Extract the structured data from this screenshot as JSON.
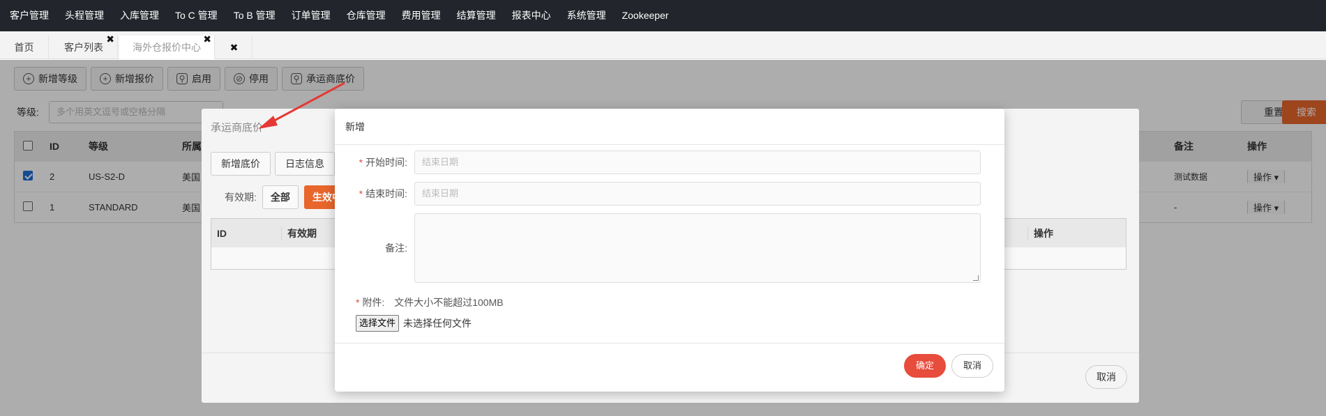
{
  "nav": {
    "items": [
      "客户管理",
      "头程管理",
      "入库管理",
      "To C 管理",
      "To B 管理",
      "订单管理",
      "仓库管理",
      "费用管理",
      "结算管理",
      "报表中心",
      "系统管理",
      "Zookeeper"
    ]
  },
  "tabs": {
    "home": "首页",
    "customer_list": "客户列表",
    "quote_center": "海外仓报价中心",
    "close_glyph": "✖"
  },
  "toolbar": {
    "add_level": "新增等级",
    "add_quote": "新增报价",
    "enable": "启用",
    "disable": "停用",
    "carrier_floor": "承运商底价"
  },
  "filter": {
    "level_label": "等级:",
    "level_placeholder": "多个用英文逗号或空格分隔",
    "reset": "重置",
    "search": "搜索"
  },
  "grid": {
    "headers": [
      "ID",
      "等级",
      "所属",
      "备注",
      "操作"
    ],
    "rows": [
      {
        "id": "2",
        "level": "US-S2-D",
        "region": "美国",
        "remark": "测试数据",
        "action": "操作 ▾",
        "checked": true
      },
      {
        "id": "1",
        "level": "STANDARD",
        "region": "美国",
        "remark": "-",
        "action": "操作 ▾",
        "checked": false
      }
    ]
  },
  "back_dialog": {
    "title": "承运商底价",
    "tabs": [
      "新增底价",
      "日志信息"
    ],
    "validity_label": "有效期:",
    "seg_all": "全部",
    "seg_active": "生效中",
    "table_headers": [
      "ID",
      "有效期",
      "操作"
    ],
    "cancel": "取消"
  },
  "dialog": {
    "title": "新增",
    "start_label": "开始时间:",
    "start_placeholder": "结束日期",
    "end_label": "结束时间:",
    "end_placeholder": "结束日期",
    "remark_label": "备注:",
    "attach_label": "附件:",
    "attach_hint": "文件大小不能超过100MB",
    "file_button": "选择文件",
    "file_status": "未选择任何文件",
    "ok": "确定",
    "cancel": "取消",
    "required_mark": "*"
  },
  "colors": {
    "nav_bg": "#22252b",
    "accent_orange": "#e8662c",
    "ok_red": "#e74c3c",
    "annotation_arrow": "#e53935"
  }
}
